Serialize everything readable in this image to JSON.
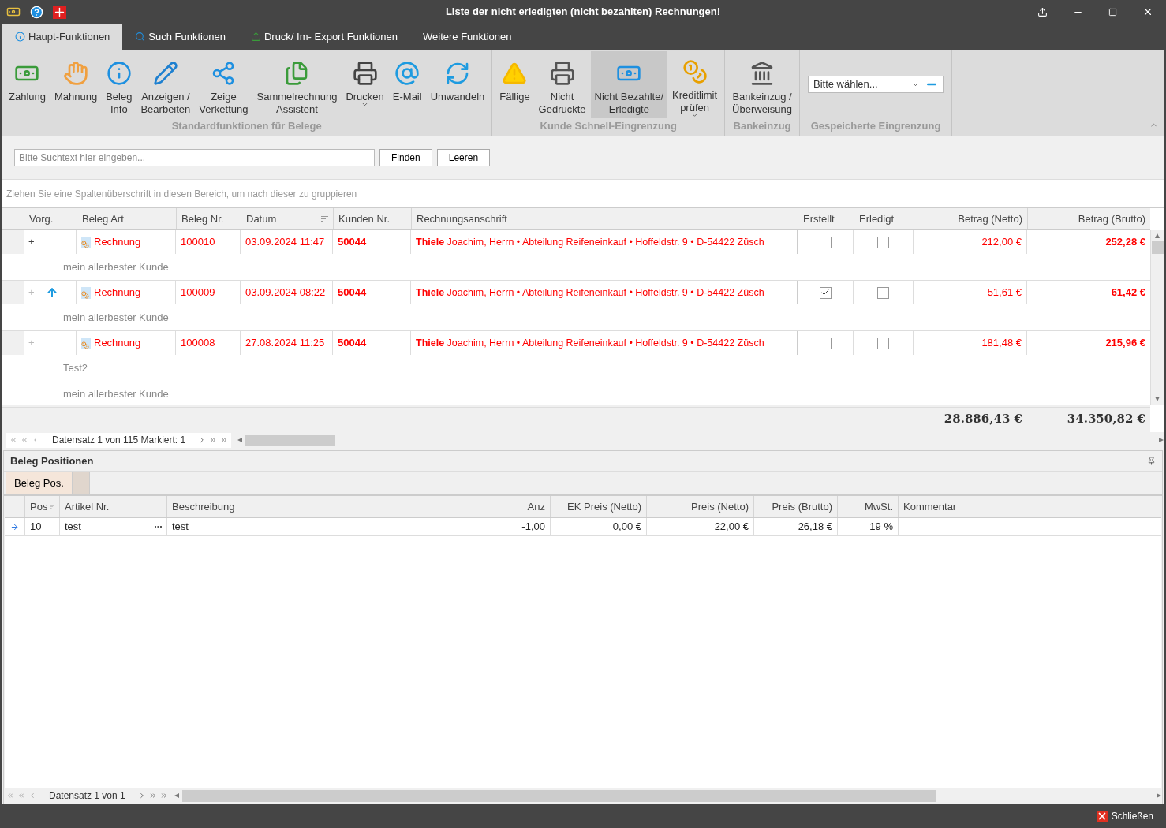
{
  "window": {
    "title": "Liste der nicht erledigten (nicht bezahlten) Rechnungen!"
  },
  "ribbon_tabs": [
    {
      "label": "Haupt-Funktionen",
      "selected": true
    },
    {
      "label": "Such Funktionen",
      "selected": false
    },
    {
      "label": "Druck/ Im- Export Funktionen",
      "selected": false
    },
    {
      "label": "Weitere Funktionen",
      "selected": false
    }
  ],
  "ribbon_groups": [
    {
      "title": "Standardfunktionen für Belege",
      "buttons": [
        {
          "lines": [
            "Zahlung"
          ],
          "dropdown": false,
          "selected": false
        },
        {
          "lines": [
            "Mahnung"
          ],
          "dropdown": false,
          "selected": false
        },
        {
          "lines": [
            "Beleg",
            "Info"
          ],
          "dropdown": false,
          "selected": false
        },
        {
          "lines": [
            "Anzeigen /",
            "Bearbeiten"
          ],
          "dropdown": false,
          "selected": false
        },
        {
          "lines": [
            "Zeige",
            "Verkettung"
          ],
          "dropdown": false,
          "selected": false
        },
        {
          "lines": [
            "Sammelrechnung",
            "Assistent"
          ],
          "dropdown": false,
          "selected": false
        },
        {
          "lines": [
            "Drucken"
          ],
          "dropdown": true,
          "selected": false
        },
        {
          "lines": [
            "E-Mail"
          ],
          "dropdown": false,
          "selected": false
        },
        {
          "lines": [
            "Umwandeln"
          ],
          "dropdown": false,
          "selected": false
        }
      ]
    },
    {
      "title": "Kunde Schnell-Eingrenzung",
      "buttons": [
        {
          "lines": [
            "Fällige"
          ],
          "dropdown": false,
          "selected": false
        },
        {
          "lines": [
            "Nicht",
            "Gedruckte"
          ],
          "dropdown": false,
          "selected": false
        },
        {
          "lines": [
            "Nicht Bezahlte/",
            "Erledigte"
          ],
          "dropdown": false,
          "selected": true
        },
        {
          "lines": [
            "Kreditlimit",
            "prüfen"
          ],
          "dropdown": true,
          "selected": false
        }
      ]
    },
    {
      "title": "Bankeinzug",
      "buttons": [
        {
          "lines": [
            "Bankeinzug /",
            "Überweisung"
          ],
          "dropdown": false,
          "selected": false
        }
      ]
    }
  ],
  "saved_filter": {
    "title": "Gespeicherte Eingrenzung",
    "value": "Bitte wählen..."
  },
  "search": {
    "placeholder": "Bitte Suchtext hier eingeben...",
    "buttons": [
      "Finden",
      "Leeren"
    ]
  },
  "group_hint": "Ziehen Sie eine Spaltenüberschrift in diesen Bereich, um nach dieser zu gruppieren",
  "table": {
    "columns": [
      "Vorg.",
      "Beleg Art",
      "Beleg Nr.",
      "Datum",
      "Kunden Nr.",
      "Rechnungsanschrift",
      "Erstellt",
      "Erledigt",
      "Betrag (Netto)",
      "Betrag (Brutto)"
    ],
    "rows": [
      {
        "expand": "+",
        "expand_enabled": true,
        "linked": false,
        "type": "Rechnung",
        "number": "100010",
        "date": "03.09.2024 11:47",
        "customer": "50044",
        "address": "**Thiele** Joachim, Herrn • Abteilung Reifeneinkauf • Hoffeldstr. 9 • D-54422 Züsch",
        "erstellt": false,
        "erledigt": false,
        "netto": "212,00 €",
        "brutto": "252,28 €",
        "notes": [
          "mein allerbester Kunde"
        ]
      },
      {
        "expand": "+",
        "expand_enabled": false,
        "linked": true,
        "type": "Rechnung",
        "number": "100009",
        "date": "03.09.2024 08:22",
        "customer": "50044",
        "address": "**Thiele** Joachim, Herrn • Abteilung Reifeneinkauf • Hoffeldstr. 9 • D-54422 Züsch",
        "erstellt": true,
        "erledigt": false,
        "netto": "51,61 €",
        "brutto": "61,42 €",
        "notes": [
          "mein allerbester Kunde"
        ]
      },
      {
        "expand": "+",
        "expand_enabled": false,
        "linked": false,
        "type": "Rechnung",
        "number": "100008",
        "date": "27.08.2024 11:25",
        "customer": "50044",
        "address": "**Thiele** Joachim, Herrn • Abteilung Reifeneinkauf • Hoffeldstr. 9 • D-54422 Züsch",
        "erstellt": false,
        "erledigt": false,
        "netto": "181,48 €",
        "brutto": "215,96 €",
        "notes": [
          "Test2",
          "mein allerbester Kunde"
        ]
      }
    ],
    "totals": {
      "netto": "28.886,43 €",
      "brutto": "34.350,82 €"
    },
    "pager": "Datensatz 1 von 115 Markiert: 1"
  },
  "positions": {
    "title": "Beleg Positionen",
    "tabs": [
      {
        "label": "Beleg Pos.",
        "selected": true
      }
    ],
    "columns": [
      "Pos",
      "Artikel Nr.",
      "Beschreibung",
      "Anz",
      "EK Preis (Netto)",
      "Preis (Netto)",
      "Preis (Brutto)",
      "MwSt.",
      "Kommentar"
    ],
    "rows": [
      {
        "current": true,
        "cells": [
          "10",
          "test",
          "test",
          "-1,00",
          "0,00 €",
          "22,00 €",
          "26,18 €",
          "19 %",
          ""
        ]
      }
    ],
    "pager": "Datensatz 1 von 1"
  },
  "close_button": "Schließen"
}
